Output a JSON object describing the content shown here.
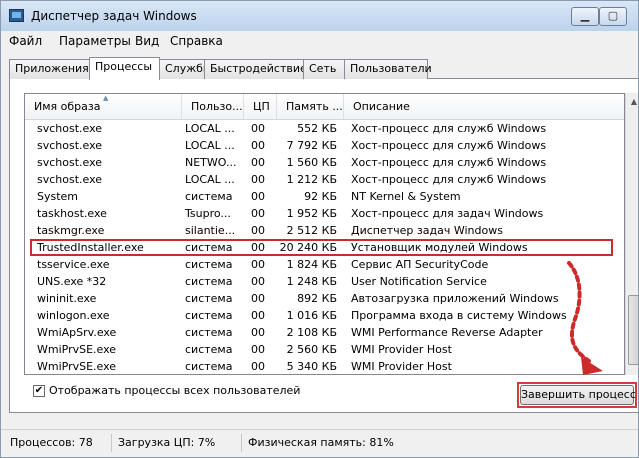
{
  "window": {
    "title": "Диспетчер задач Windows"
  },
  "menu": [
    {
      "label": "Файл"
    },
    {
      "label": "Параметры"
    },
    {
      "label": "Вид"
    },
    {
      "label": "Справка"
    }
  ],
  "tabs": [
    {
      "label": "Приложения"
    },
    {
      "label": "Процессы"
    },
    {
      "label": "Службы"
    },
    {
      "label": "Быстродействие"
    },
    {
      "label": "Сеть"
    },
    {
      "label": "Пользователи"
    }
  ],
  "active_tab": "Процессы",
  "columns": [
    {
      "label": "Имя образа"
    },
    {
      "label": "Пользо..."
    },
    {
      "label": "ЦП"
    },
    {
      "label": "Память ..."
    },
    {
      "label": "Описание"
    }
  ],
  "rows": [
    {
      "name": "svchost.exe",
      "user": "LOCAL ...",
      "cpu": "00",
      "mem": "552 КБ",
      "desc": "Хост-процесс для служб Windows"
    },
    {
      "name": "svchost.exe",
      "user": "LOCAL ...",
      "cpu": "00",
      "mem": "7 792 КБ",
      "desc": "Хост-процесс для служб Windows"
    },
    {
      "name": "svchost.exe",
      "user": "NETWO...",
      "cpu": "00",
      "mem": "1 560 КБ",
      "desc": "Хост-процесс для служб Windows"
    },
    {
      "name": "svchost.exe",
      "user": "LOCAL ...",
      "cpu": "00",
      "mem": "1 212 КБ",
      "desc": "Хост-процесс для служб Windows"
    },
    {
      "name": "System",
      "user": "система",
      "cpu": "00",
      "mem": "92 КБ",
      "desc": "NT Kernel & System"
    },
    {
      "name": "taskhost.exe",
      "user": "Tsupro...",
      "cpu": "00",
      "mem": "1 952 КБ",
      "desc": "Хост-процесс для задач Windows"
    },
    {
      "name": "taskmgr.exe",
      "user": "silantie...",
      "cpu": "00",
      "mem": "2 512 КБ",
      "desc": "Диспетчер задач Windows"
    },
    {
      "name": "TrustedInstaller.exe",
      "user": "система",
      "cpu": "00",
      "mem": "20 240 КБ",
      "desc": "Установщик модулей Windows"
    },
    {
      "name": "tsservice.exe",
      "user": "система",
      "cpu": "00",
      "mem": "1 824 КБ",
      "desc": "Сервис АП SecurityCode"
    },
    {
      "name": "UNS.exe *32",
      "user": "система",
      "cpu": "00",
      "mem": "1 248 КБ",
      "desc": "User Notification Service"
    },
    {
      "name": "wininit.exe",
      "user": "система",
      "cpu": "00",
      "mem": "892 КБ",
      "desc": "Автозагрузка приложений Windows"
    },
    {
      "name": "winlogon.exe",
      "user": "система",
      "cpu": "00",
      "mem": "1 016 КБ",
      "desc": "Программа входа в систему Windows"
    },
    {
      "name": "WmiApSrv.exe",
      "user": "система",
      "cpu": "00",
      "mem": "2 108 КБ",
      "desc": "WMI Performance Reverse Adapter"
    },
    {
      "name": "WmiPrvSE.exe",
      "user": "система",
      "cpu": "00",
      "mem": "2 560 КБ",
      "desc": "WMI Provider Host"
    },
    {
      "name": "WmiPrvSE.exe",
      "user": "система",
      "cpu": "00",
      "mem": "5 340 КБ",
      "desc": "WMI Provider Host"
    }
  ],
  "highlighted_row": "TrustedInstaller.exe",
  "show_all_checkbox": {
    "label": "Отображать процессы всех пользователей",
    "checked": true
  },
  "end_process_button": {
    "label": "Завершить процесс"
  },
  "status": {
    "processes": "Процессов: 78",
    "cpu": "Загрузка ЦП: 7%",
    "memory": "Физическая память: 81%"
  },
  "colors": {
    "highlight": "#cc2b2b",
    "arrow": "#cc2b2b"
  },
  "icons": [
    "app-icon",
    "minimize-icon",
    "maximize-icon",
    "sort-up-icon",
    "checkmark-icon",
    "scroll-up-icon"
  ]
}
